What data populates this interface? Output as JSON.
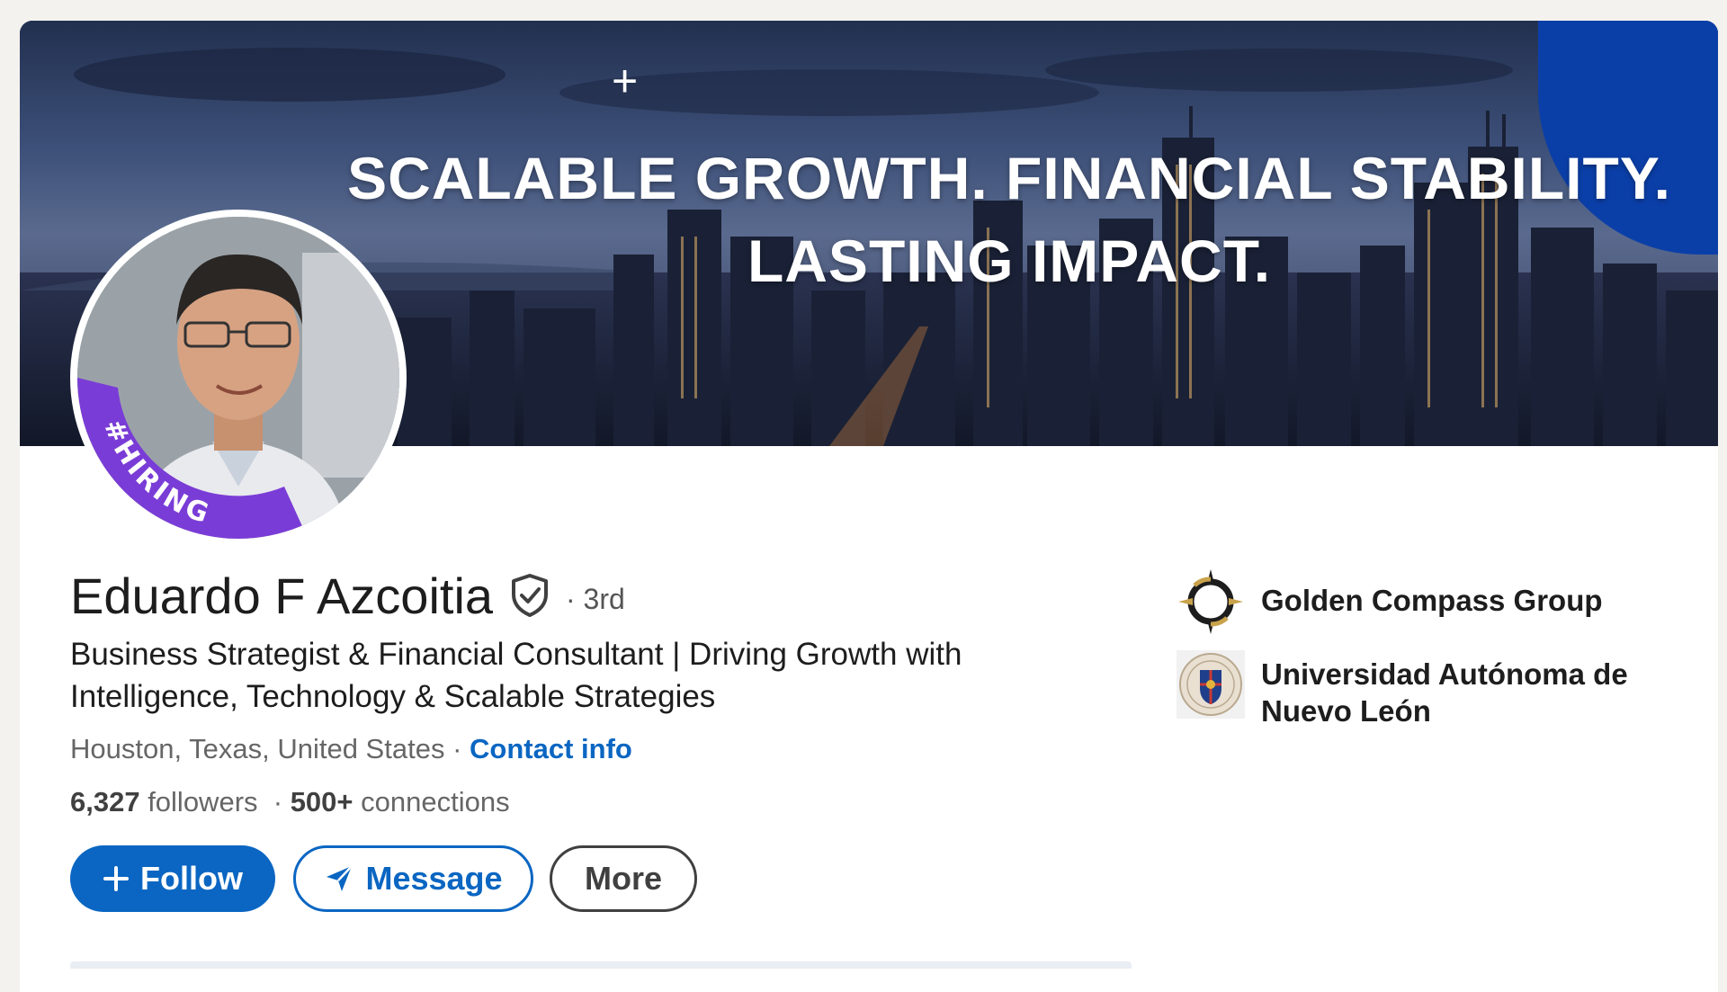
{
  "banner": {
    "plus_glyph": "+",
    "headline_line1": "SCALABLE GROWTH. FINANCIAL STABILITY.",
    "headline_line2": "LASTING IMPACT."
  },
  "profile": {
    "avatar_frame_text": "#HIRING",
    "name": "Eduardo F Azcoitia",
    "degree": "· 3rd",
    "headline": "Business Strategist & Financial Consultant | Driving Growth with Intelligence, Technology & Scalable Strategies",
    "location": "Houston, Texas, United States",
    "location_separator": " · ",
    "contact_info": "Contact info",
    "followers_count": "6,327",
    "followers_label": " followers",
    "connections_separator": "  · ",
    "connections_count": "500+",
    "connections_label": " connections"
  },
  "actions": {
    "follow": "Follow",
    "message": "Message",
    "more": "More"
  },
  "organizations": [
    {
      "name": "Golden Compass Group",
      "icon": "compass-logo-icon"
    },
    {
      "name": "Universidad Autónoma de Nuevo León",
      "icon": "university-crest-icon"
    }
  ],
  "colors": {
    "brand": "#0a66c2",
    "hiring_ring": "#7a3cd6",
    "banner_blob": "#0b3fa8"
  }
}
